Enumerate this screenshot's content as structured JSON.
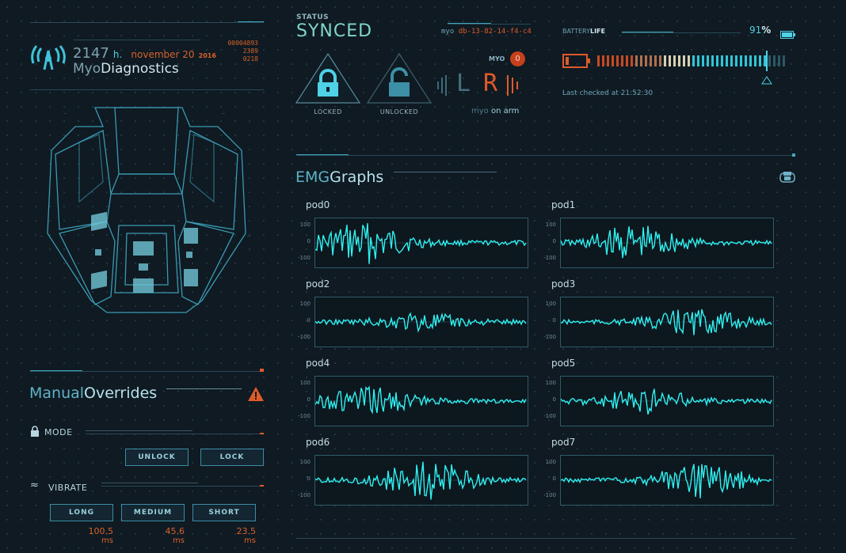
{
  "header": {
    "hours_value": "2147",
    "hours_unit": "h.",
    "date_text": "november 20",
    "date_year": "2016",
    "codes": [
      "00004893",
      "2389",
      "0218"
    ],
    "app_title_prefix": "Myo",
    "app_title_main": "Diagnostics"
  },
  "overrides": {
    "title_prefix": "Manual",
    "title_main": "Overrides",
    "mode_label": "MODE",
    "unlock_label": "UNLOCK",
    "lock_label": "LOCK",
    "vibrate_label": "VIBRATE",
    "vibrations": [
      {
        "label": "LONG",
        "value": "100.5",
        "unit": "ms"
      },
      {
        "label": "MEDIUM",
        "value": "45.6",
        "unit": "ms"
      },
      {
        "label": "SHORT",
        "value": "23.5",
        "unit": "ms"
      }
    ]
  },
  "status": {
    "label": "STATUS",
    "value": "SYNCED",
    "device_prefix": "myo",
    "device_id": "db-13-82-14-f4-c4",
    "locked_label": "LOCKED",
    "unlocked_label": "UNLOCKED",
    "myo_label": "MYO",
    "myo_count": "0",
    "arm_left": "L",
    "arm_right": "R",
    "arm_prefix": "myo",
    "arm_text": "on arm"
  },
  "battery": {
    "label_a": "BATTERY",
    "label_b": "LIFE",
    "percent_value": "91",
    "percent_sign": "%",
    "level": 0.91,
    "last_checked": "Last checked at 21:52:30"
  },
  "emg": {
    "title_prefix": "EMG",
    "title_main": "Graphs",
    "ticks": [
      "100",
      "0",
      "-100"
    ],
    "pods": [
      {
        "name": "pod0",
        "amp": 0.9
      },
      {
        "name": "pod1",
        "amp": 0.8
      },
      {
        "name": "pod2",
        "amp": 0.35
      },
      {
        "name": "pod3",
        "amp": 0.55
      },
      {
        "name": "pod4",
        "amp": 0.6
      },
      {
        "name": "pod5",
        "amp": 0.55
      },
      {
        "name": "pod6",
        "amp": 0.85
      },
      {
        "name": "pod7",
        "amp": 0.75
      }
    ]
  },
  "colors": {
    "accent": "#4fd1e6",
    "warning": "#e05a2a",
    "trace": "#2ff0f0"
  }
}
